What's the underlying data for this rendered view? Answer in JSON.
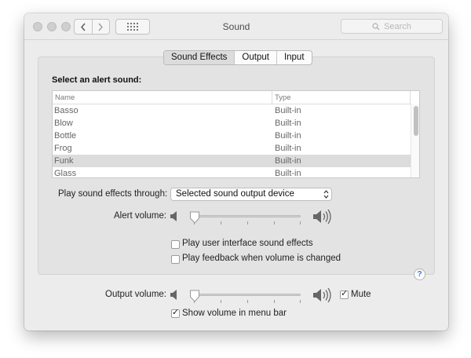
{
  "window": {
    "title": "Sound"
  },
  "toolbar": {
    "search_placeholder": "Search"
  },
  "tabs": [
    {
      "label": "Sound Effects",
      "active": true
    },
    {
      "label": "Output",
      "active": false
    },
    {
      "label": "Input",
      "active": false
    }
  ],
  "sound_effects": {
    "heading": "Select an alert sound:",
    "columns": [
      "Name",
      "Type"
    ],
    "rows": [
      {
        "name": "Basso",
        "type": "Built-in"
      },
      {
        "name": "Blow",
        "type": "Built-in"
      },
      {
        "name": "Bottle",
        "type": "Built-in"
      },
      {
        "name": "Frog",
        "type": "Built-in"
      },
      {
        "name": "Funk",
        "type": "Built-in",
        "selected": true
      },
      {
        "name": "Glass",
        "type": "Built-in"
      }
    ],
    "play_through_label": "Play sound effects through:",
    "play_through_value": "Selected sound output device",
    "alert_volume_label": "Alert volume:",
    "alert_volume_level": 0,
    "ui_sounds_label": "Play user interface sound effects",
    "ui_sounds_checked": false,
    "feedback_label": "Play feedback when volume is changed",
    "feedback_checked": false,
    "help_label": "?"
  },
  "output": {
    "volume_label": "Output volume:",
    "volume_level": 0,
    "mute_label": "Mute",
    "mute_checked": true,
    "menu_bar_label": "Show volume in menu bar",
    "menu_bar_checked": true
  },
  "colors": {
    "accent": "#3a78d8",
    "selected_row": "#dcdcdc"
  }
}
